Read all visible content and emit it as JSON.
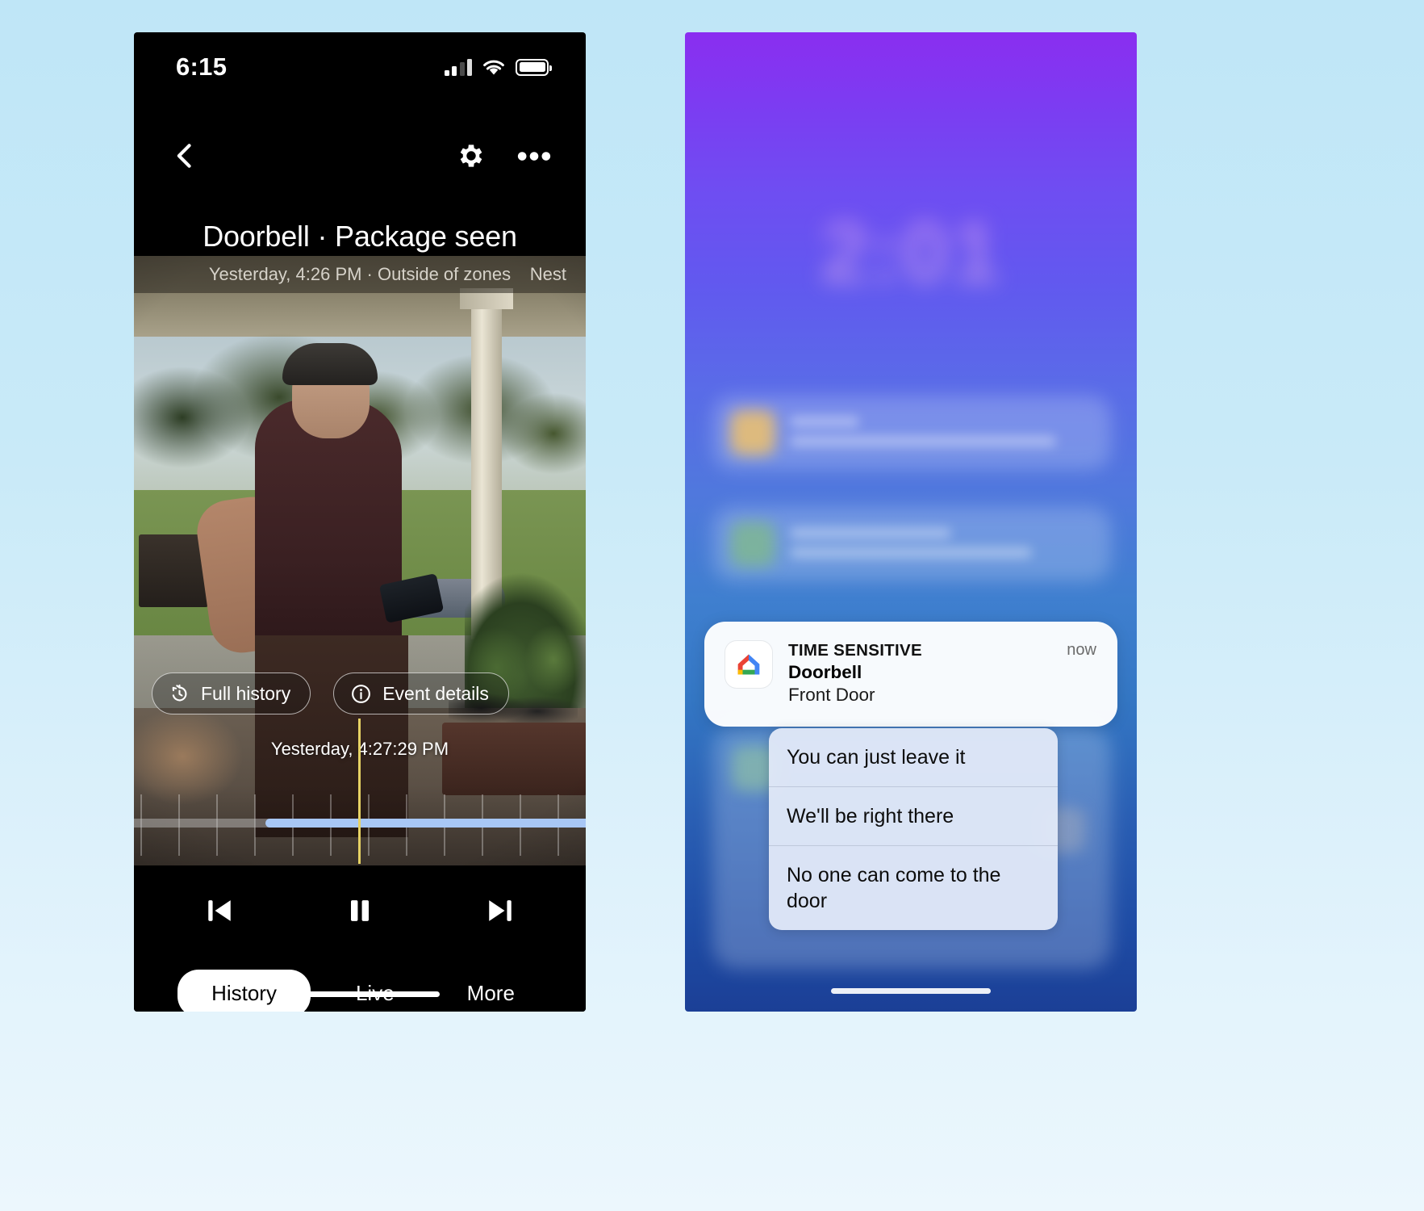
{
  "left_phone": {
    "status": {
      "time": "6:15",
      "signal_icon": "cellular-signal-icon",
      "wifi_icon": "wifi-icon",
      "battery_icon": "battery-full-icon"
    },
    "nav": {
      "back_icon": "chevron-left-icon",
      "settings_icon": "gear-icon",
      "overflow_icon": "more-horizontal-icon"
    },
    "event": {
      "title": "Doorbell · Package seen",
      "subtitle": "Yesterday, 4:26 PM · Outside of zones",
      "brand_badge": "Nest"
    },
    "chips": [
      {
        "label": "Full history",
        "icon": "history-clock-icon"
      },
      {
        "label": "Event details",
        "icon": "info-circle-icon"
      }
    ],
    "playhead_time": "Yesterday, 4:27:29 PM",
    "controls": [
      {
        "name": "skip-previous-button",
        "icon": "skip-previous-icon"
      },
      {
        "name": "pause-button",
        "icon": "pause-icon"
      },
      {
        "name": "skip-next-button",
        "icon": "skip-next-icon"
      }
    ],
    "tabs": [
      {
        "label": "History",
        "active": true
      },
      {
        "label": "Live",
        "active": false
      },
      {
        "label": "More",
        "active": false
      }
    ],
    "colors": {
      "timeline_fill": "#a8c7f5",
      "playhead": "#e6d264",
      "active_tab_bg": "#ffffff"
    }
  },
  "right_phone": {
    "lock_screen": {
      "clock": "2:01",
      "date": ""
    },
    "notification": {
      "kicker": "TIME SENSITIVE",
      "title": "Doorbell",
      "subtitle": "Front Door",
      "timestamp": "now",
      "app_icon": "google-home-icon"
    },
    "quick_replies": [
      "You can just leave it",
      "We'll be right there",
      "No one can come to the door"
    ],
    "colors": {
      "gradient_top": "#8a2ef0",
      "gradient_bottom": "#1b3f96",
      "reply_bg": "#e2e9f8"
    }
  }
}
